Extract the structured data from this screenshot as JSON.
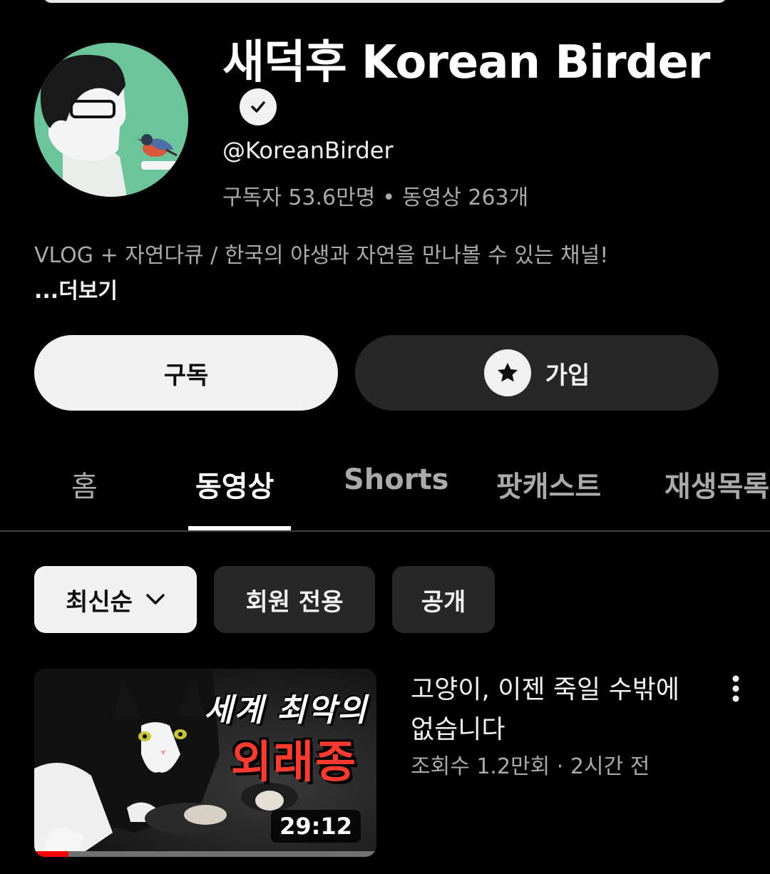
{
  "channel": {
    "name": "새덕후 Korean Birder",
    "handle": "@KoreanBirder",
    "subscribers": "구독자 53.6만명",
    "videos_count": "동영상 263개",
    "separator": "•",
    "description": "VLOG + 자연다큐 / 한국의 야생과 자연을 만나볼 수 있는 채널!",
    "more_label": "...더보기",
    "verified_icon": "verified-check-icon"
  },
  "actions": {
    "subscribe_label": "구독",
    "join_label": "가입",
    "join_icon": "star-icon"
  },
  "tabs": [
    {
      "label": "홈",
      "active": false
    },
    {
      "label": "동영상",
      "active": true
    },
    {
      "label": "Shorts",
      "active": false
    },
    {
      "label": "팟캐스트",
      "active": false
    },
    {
      "label": "재생목록",
      "active": false
    }
  ],
  "filters": {
    "sort_label": "최신순",
    "members_label": "회원 전용",
    "public_label": "공개"
  },
  "video": {
    "title": "고양이, 이젠 죽일 수밖에 없습니다",
    "views": "조회수 1.2만회",
    "meta_separator": "·",
    "age": "2시간 전",
    "duration": "29:12",
    "thumbnail_text_top": "세계 최악의",
    "thumbnail_text_main": "외래종",
    "watch_progress": 0.1
  },
  "colors": {
    "background": "#000000",
    "accent_red": "#ff0000",
    "chip_dark": "#272727",
    "chip_light": "#f1f1f1"
  }
}
